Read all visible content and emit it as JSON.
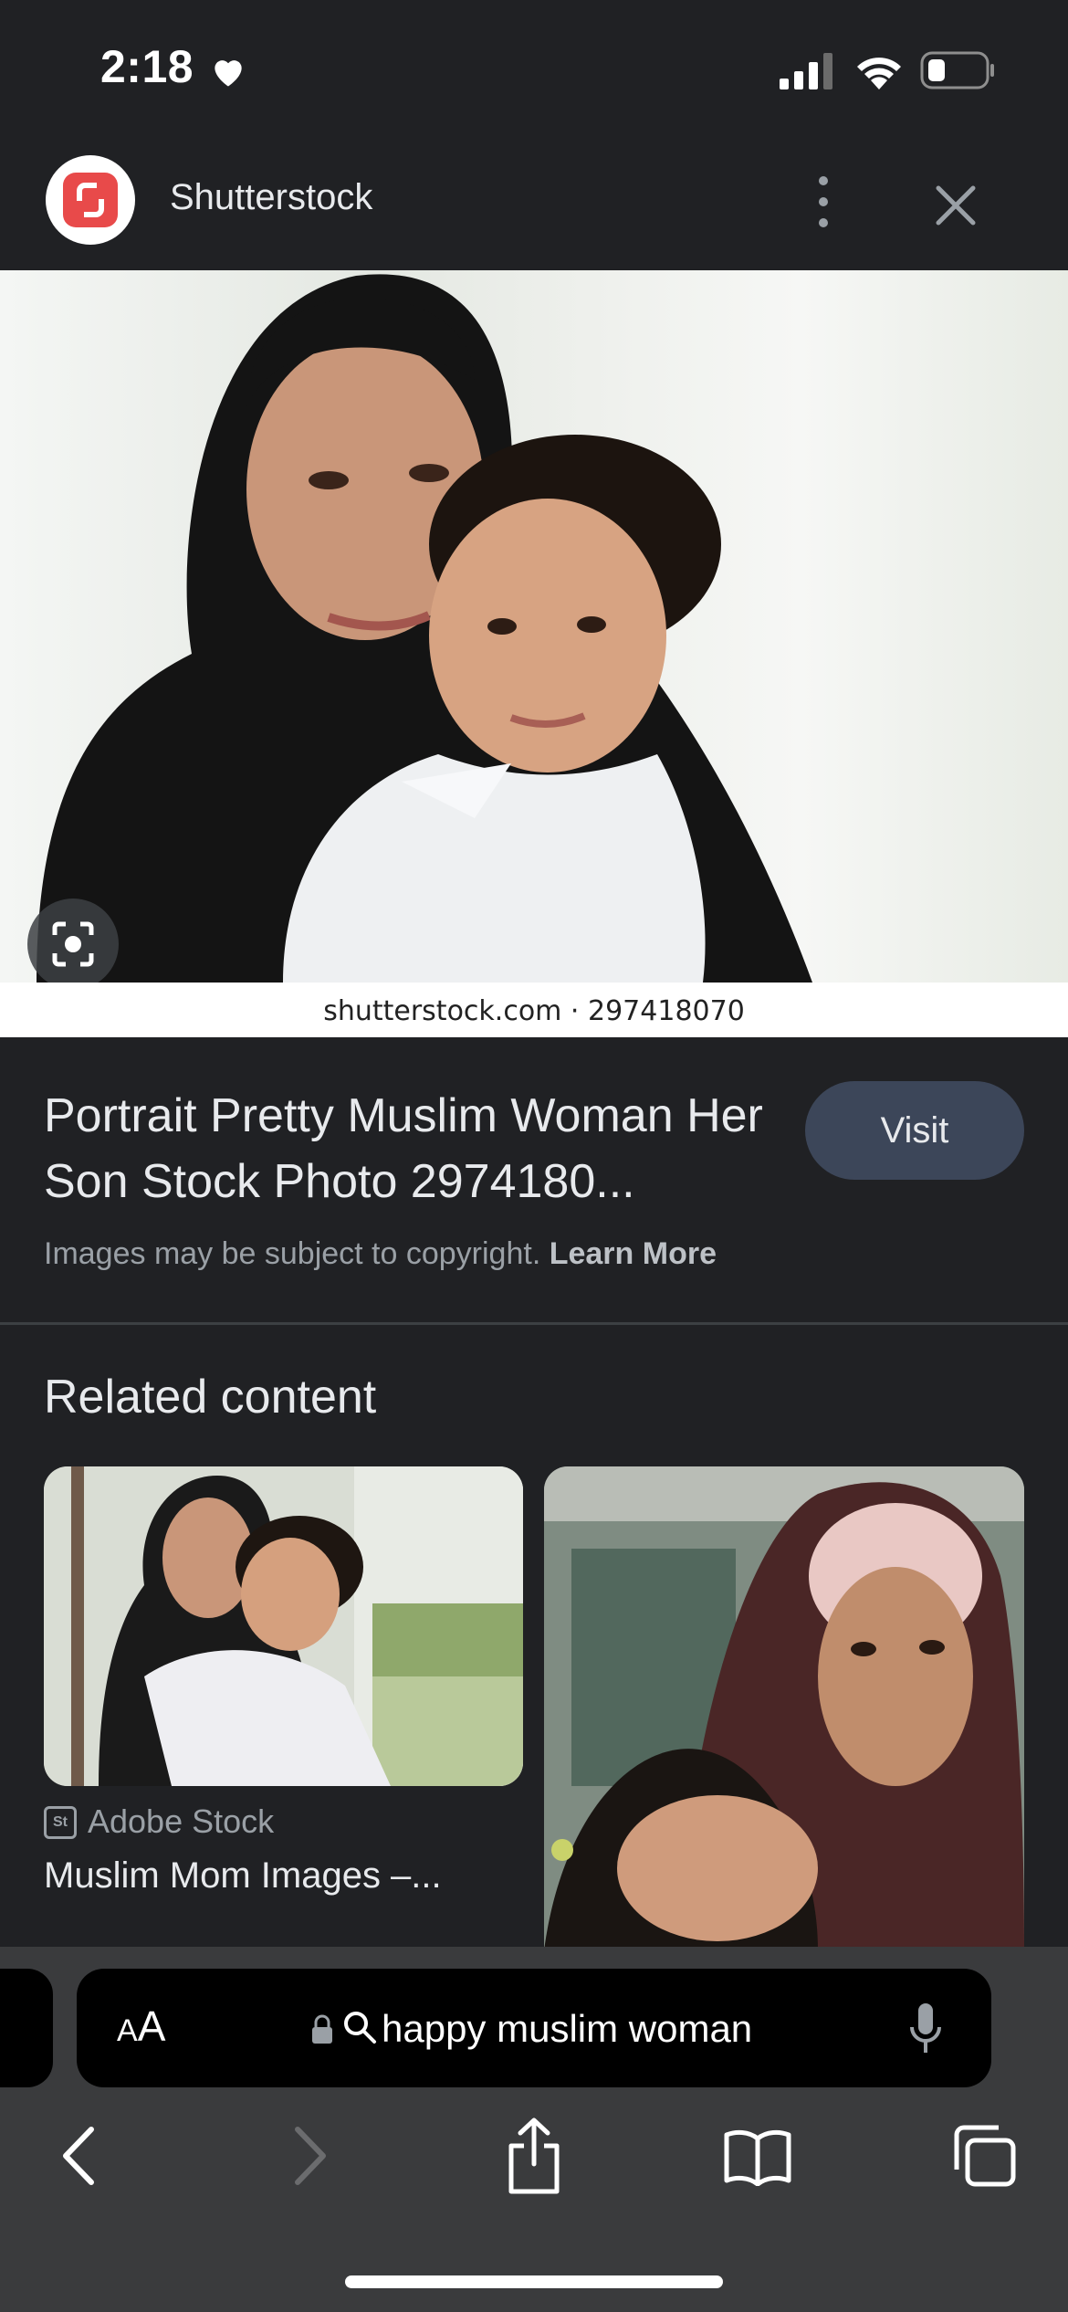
{
  "status_bar": {
    "time": "2:18"
  },
  "header": {
    "site_name": "Shutterstock"
  },
  "hero": {
    "credit": "shutterstock.com · 297418070"
  },
  "result": {
    "title": "Portrait Pretty Muslim Woman Her Son Stock Photo 2974180...",
    "visit_label": "Visit",
    "copyright_text": "Images may be subject to copyright.",
    "learn_more_label": "Learn More"
  },
  "related": {
    "heading": "Related content",
    "cards": [
      {
        "source_icon_text": "St",
        "source": "Adobe Stock",
        "title": "Muslim Mom Images –..."
      }
    ]
  },
  "browser": {
    "aa_label_small": "A",
    "aa_label_large": "A",
    "url_text": "happy muslim woman"
  },
  "colors": {
    "accent_logo": "#e84a4a",
    "visit_button": "#3c4659",
    "background": "#202124"
  }
}
